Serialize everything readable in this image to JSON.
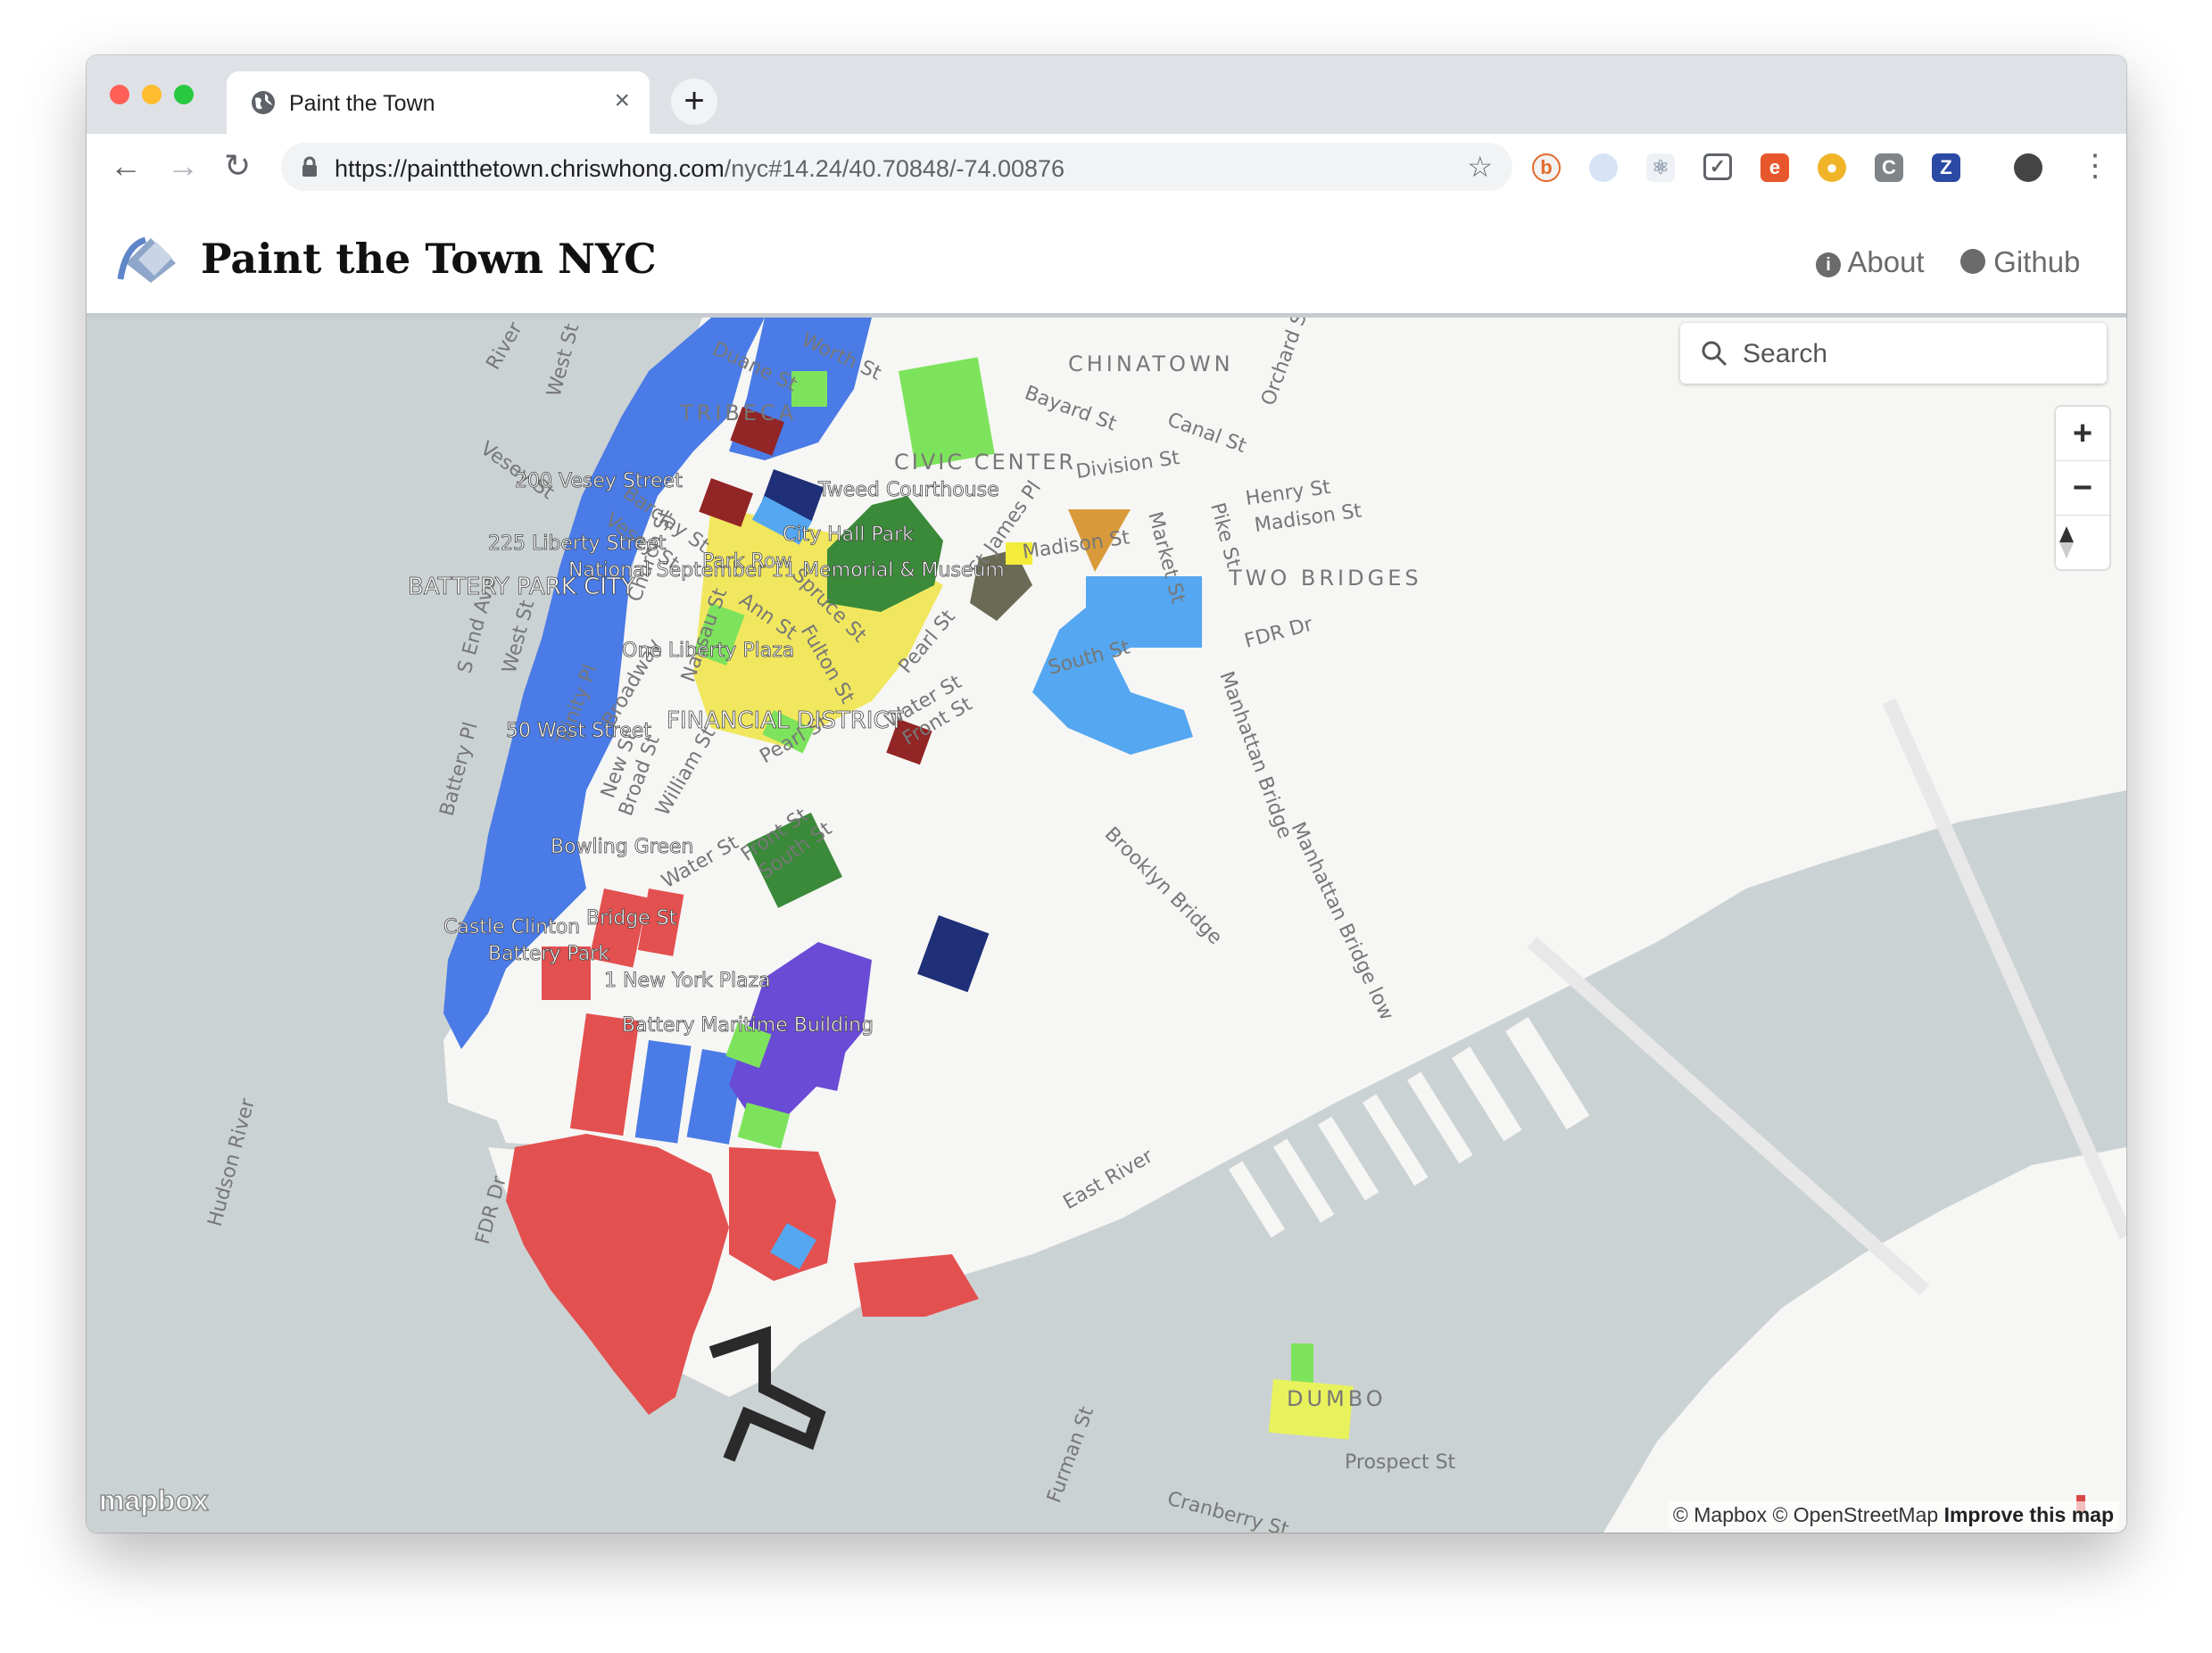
{
  "browser": {
    "tab_title": "Paint the Town",
    "tab_close": "×",
    "new_tab": "+",
    "url_host": "https://paintthetown.chriswhong.com",
    "url_path": "/nyc#14.24/40.70848/-74.00876"
  },
  "header": {
    "title": "Paint the Town NYC",
    "about_label": "About",
    "github_label": "Github"
  },
  "map": {
    "search_placeholder": "Search",
    "zoom_in": "+",
    "zoom_out": "−",
    "attribution": "© Mapbox © OpenStreetMap",
    "improve": "Improve this map",
    "logo": "mapbox",
    "colors": {
      "water": "#cbd2d3",
      "land": "#f6f6f4",
      "blue": "#4a7be6",
      "red": "#e35050",
      "lightblue": "#54a7f0",
      "green": "#7ee35c",
      "darkgreen": "#3a8a3a",
      "yellow": "#f1e75e",
      "purple": "#6a4bd6",
      "navy": "#1f2f78",
      "darkred": "#922525",
      "orange": "#e8a23f"
    },
    "labels": {
      "tribeca": "TRIBECA",
      "chinatown": "CHINATOWN",
      "civic_center": "CIVIC CENTER",
      "two_bridges": "TWO BRIDGES",
      "battery_park_city": "BATTERY PARK CITY",
      "financial_district": "FINANCIAL DISTRICT",
      "dumbo": "DUMBO",
      "hudson_river": "Hudson River",
      "east_river": "East River",
      "vesey_st_200": "200 Vesey Street",
      "liberty_225": "225 Liberty Street",
      "memorial": "National September 11 Memorial & Museum",
      "one_liberty": "One Liberty Plaza",
      "west_street_50": "50 West Street",
      "tweed": "Tweed Courthouse",
      "city_hall_park": "City Hall Park",
      "park_row": "Park Row",
      "bowling_green": "Bowling Green",
      "castle_clinton": "Castle Clinton",
      "battery_park": "Battery Park",
      "bridge_st": "Bridge St",
      "ny_plaza": "1 New York Plaza",
      "battery_maritime": "Battery Maritime Building",
      "duane_st": "Duane St",
      "worth_st": "Worth St",
      "bayard_st": "Bayard St",
      "canal_st": "Canal St",
      "division_st": "Division St",
      "henry_st": "Henry St",
      "madison_st": "Madison St",
      "madison_st2": "Madison St",
      "market_st": "Market St",
      "pike_st": "Pike St",
      "st_james_pl": "St James Pl",
      "fdr_dr": "FDR Dr",
      "south_st": "South St",
      "manhattan_bridge": "Manhattan Bridge",
      "brooklyn_bridge": "Brooklyn Bridge",
      "pearl_st": "Pearl St",
      "water_st": "Water St",
      "front_st": "Front St",
      "fulton_st": "Fulton St",
      "spruce_st": "Spruce St",
      "ann_st": "Ann St",
      "nassau_st": "Nassau St",
      "church_st": "Church St",
      "barclay_st": "Barclay St",
      "vesey_st": "Vesey St",
      "west_st": "West St",
      "trinity_pl": "Trinity Pl",
      "broadway": "Broadway",
      "new_st": "New St",
      "broad_st": "Broad St",
      "william_st": "William St",
      "river_ter": "River Ter",
      "s_end_ave": "S End Ave",
      "battery_pl": "Battery Pl",
      "furman_st": "Furman St",
      "cranberry_st": "Cranberry St",
      "prospect_st": "Prospect St",
      "orchard_st": "Orchard St",
      "manhattan_bridge_lower": "Manhattan Bridge low"
    }
  }
}
